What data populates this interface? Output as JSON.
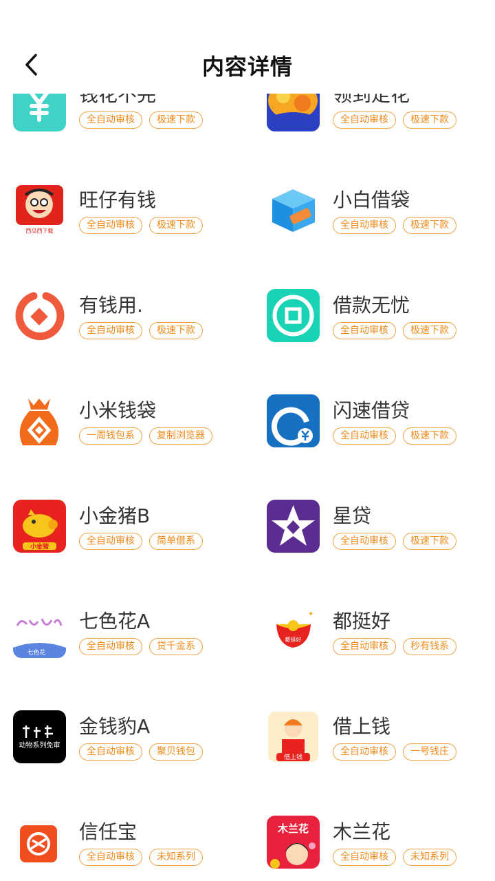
{
  "header": {
    "title": "内容详情"
  },
  "items": [
    {
      "name": "钱花不完",
      "tags": [
        "全自动审核",
        "极速下款"
      ],
      "icon": "yuan-icon"
    },
    {
      "name": "领到走花",
      "tags": [
        "全自动审核",
        "极速下款"
      ],
      "icon": "coins-icon"
    },
    {
      "name": "旺仔有钱",
      "tags": [
        "全自动审核",
        "极速下款"
      ],
      "icon": "wangzai-icon",
      "icon_text": "西瓜西下载"
    },
    {
      "name": "小白借袋",
      "tags": [
        "全自动审核",
        "极速下款"
      ],
      "icon": "cube-icon"
    },
    {
      "name": "有钱用.",
      "tags": [
        "全自动审核",
        "极速下款"
      ],
      "icon": "ring-diamond-icon"
    },
    {
      "name": "借款无忧",
      "tags": [
        "全自动审核",
        "极速下款"
      ],
      "icon": "coin-square-icon"
    },
    {
      "name": "小米钱袋",
      "tags": [
        "一周钱包系",
        "复制浏览器"
      ],
      "icon": "money-bag-icon"
    },
    {
      "name": "闪速借贷",
      "tags": [
        "全自动审核",
        "极速下款"
      ],
      "icon": "q-yuan-icon"
    },
    {
      "name": "小金猪B",
      "tags": [
        "全自动审核",
        "简单借系"
      ],
      "icon": "gold-pig-icon",
      "icon_text": "小金猪"
    },
    {
      "name": "星贷",
      "tags": [
        "全自动审核",
        "极速下款"
      ],
      "icon": "star-icon"
    },
    {
      "name": "七色花A",
      "tags": [
        "全自动审核",
        "贷千金系"
      ],
      "icon": "qisehua-icon",
      "icon_text": "七色花"
    },
    {
      "name": "都挺好",
      "tags": [
        "全自动审核",
        "秒有钱系"
      ],
      "icon": "red-envelope-icon",
      "icon_text": "都挺好"
    },
    {
      "name": "金钱豹A",
      "tags": [
        "全自动审核",
        "聚贝钱包"
      ],
      "icon": "leopard-text-icon",
      "icon_text": "动物系列免审"
    },
    {
      "name": "借上钱",
      "tags": [
        "全自动审核",
        "一号钱庄"
      ],
      "icon": "girl-icon",
      "icon_text": "借上钱"
    },
    {
      "name": "信任宝",
      "tags": [
        "全自动审核",
        "未知系列"
      ],
      "icon": "trust-icon"
    },
    {
      "name": "木兰花",
      "tags": [
        "全自动审核",
        "未知系列"
      ],
      "icon": "mulan-icon",
      "icon_text": "木兰花"
    }
  ]
}
